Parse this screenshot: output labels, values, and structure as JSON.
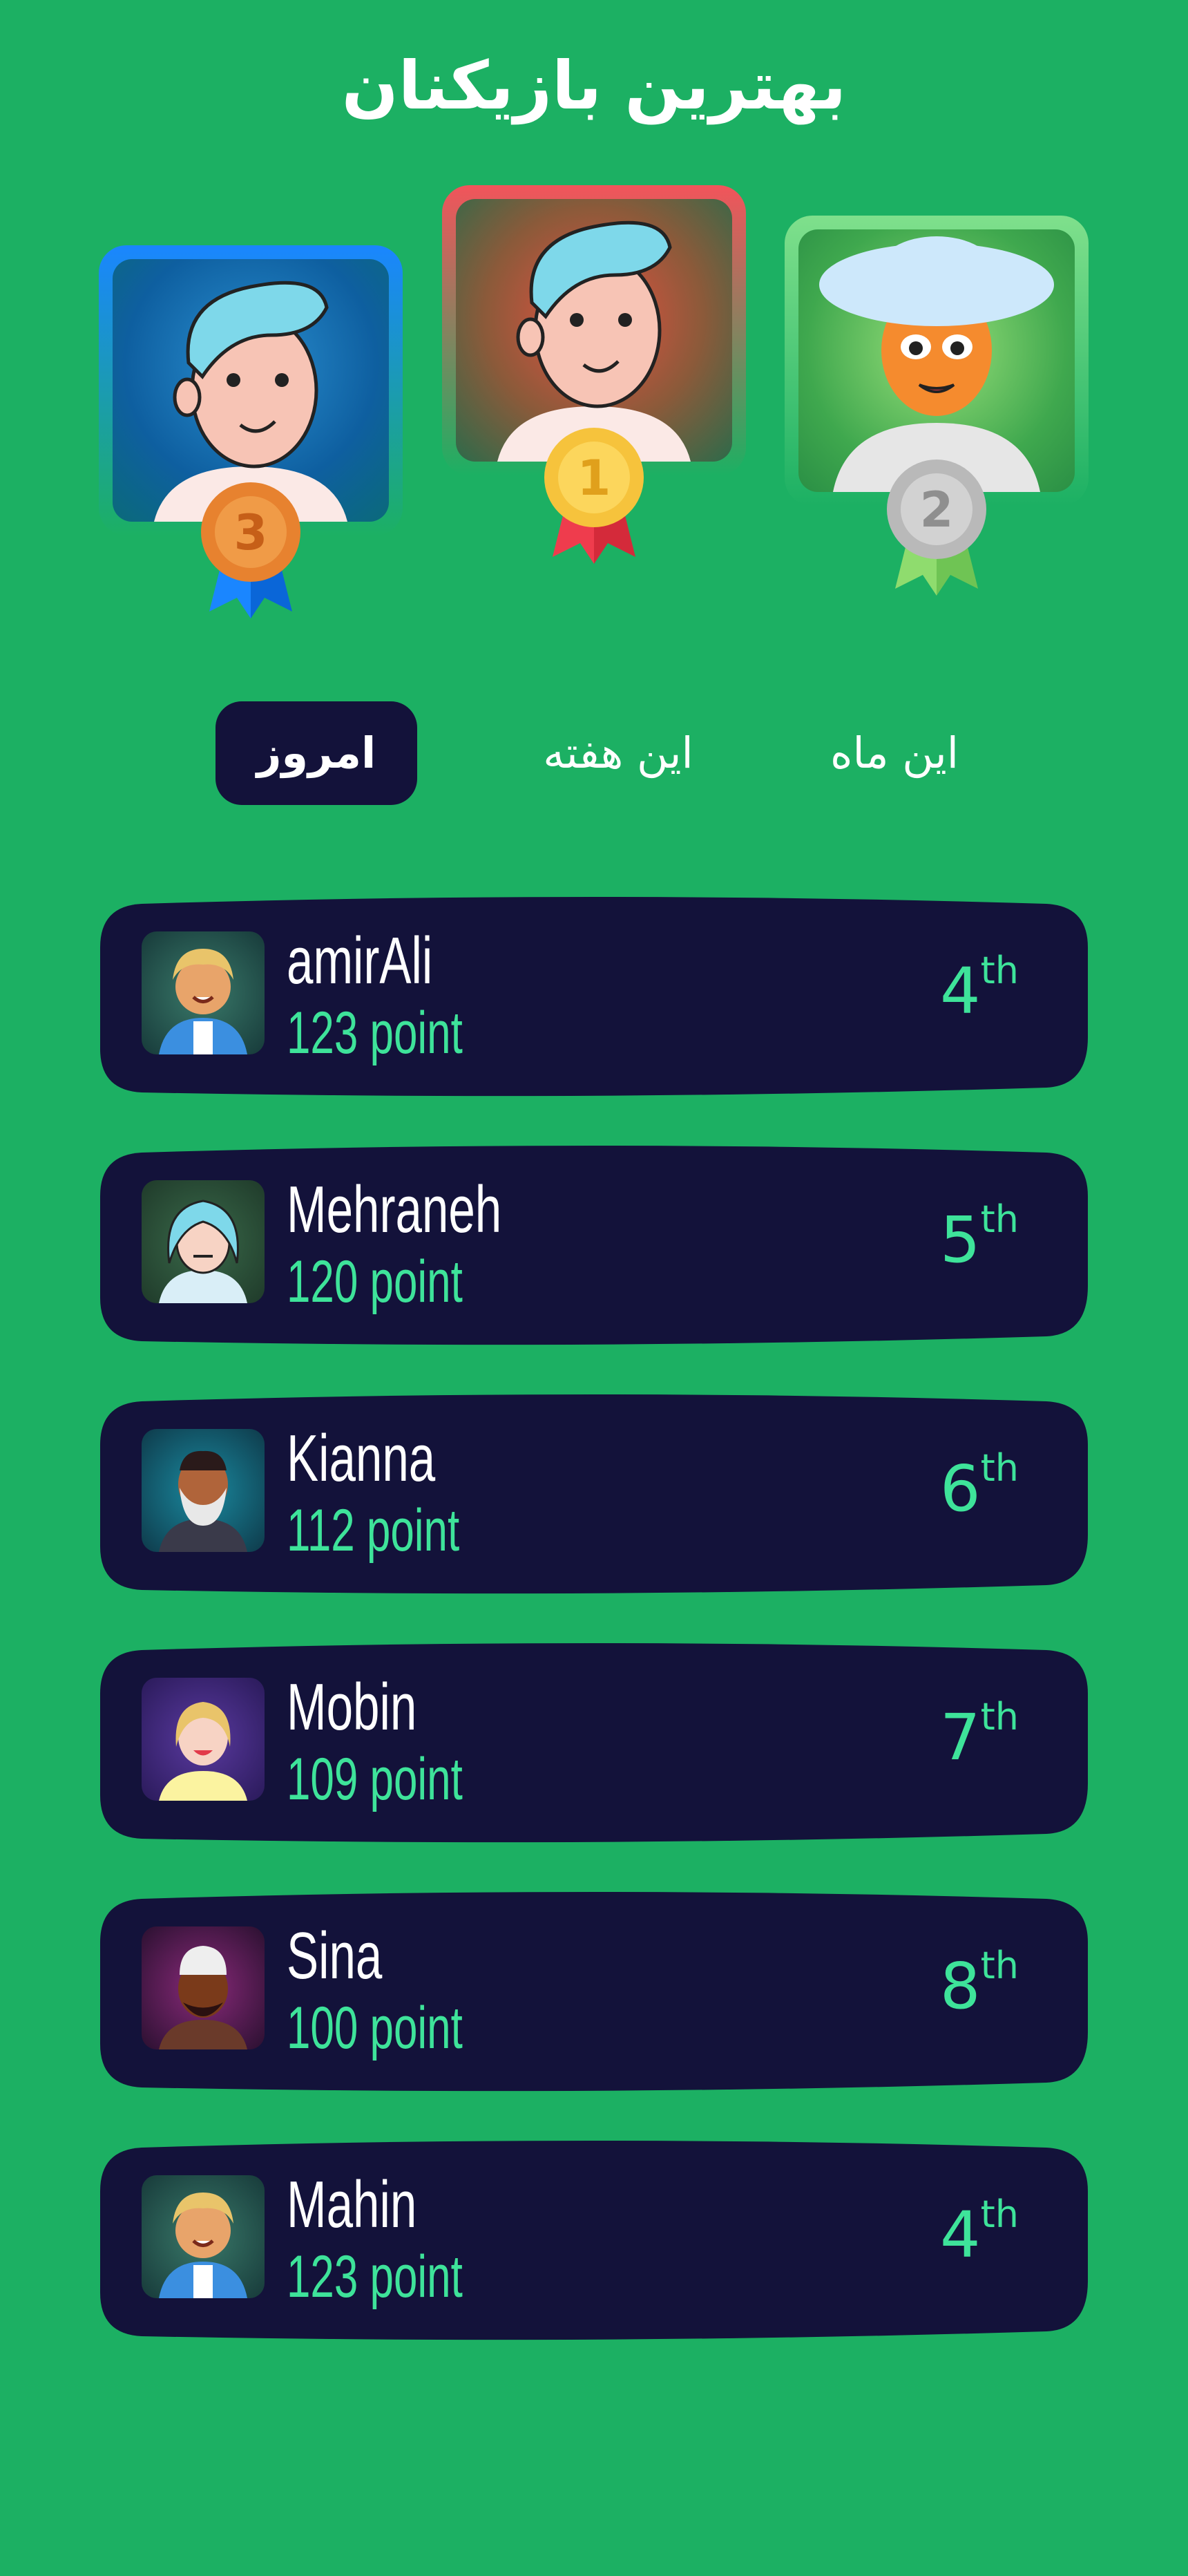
{
  "header": {
    "title": "بهترین بازیکنان"
  },
  "podium": [
    {
      "place": "1",
      "medal_icon": "gold-medal-icon",
      "frame_color": "#f2545b",
      "medal_color": "#f6c33c",
      "ribbon_color": "#ef3c4d"
    },
    {
      "place": "2",
      "medal_icon": "silver-medal-icon",
      "frame_color": "#7fe08c",
      "medal_color": "#b9b9b9",
      "ribbon_color": "#8fdc6e"
    },
    {
      "place": "3",
      "medal_icon": "bronze-medal-icon",
      "frame_color": "#1a86ff",
      "medal_color": "#e7822f",
      "ribbon_color": "#1a86ff"
    }
  ],
  "tabs": {
    "today": "امروز",
    "week": "این هفته",
    "month": "این ماه",
    "active": "today"
  },
  "players": [
    {
      "name": "amirAli",
      "points": "123 point",
      "rank": "4",
      "suffix": "th",
      "avatar_icon": "curly-blonde-boy-avatar"
    },
    {
      "name": "Mehraneh",
      "points": "120 point",
      "rank": "5",
      "suffix": "th",
      "avatar_icon": "blue-haired-girl-avatar"
    },
    {
      "name": "Kianna",
      "points": "112 point",
      "rank": "6",
      "suffix": "th",
      "avatar_icon": "bearded-man-avatar"
    },
    {
      "name": "Mobin",
      "points": "109 point",
      "rank": "7",
      "suffix": "th",
      "avatar_icon": "blonde-woman-avatar"
    },
    {
      "name": "Sina",
      "points": "100 point",
      "rank": "8",
      "suffix": "th",
      "avatar_icon": "beanie-man-avatar"
    },
    {
      "name": "Mahin",
      "points": "123 point",
      "rank": "4",
      "suffix": "th",
      "avatar_icon": "curly-blonde-boy-avatar"
    }
  ],
  "colors": {
    "background": "#1cb063",
    "card": "#13123a",
    "accent": "#3ee39a"
  }
}
